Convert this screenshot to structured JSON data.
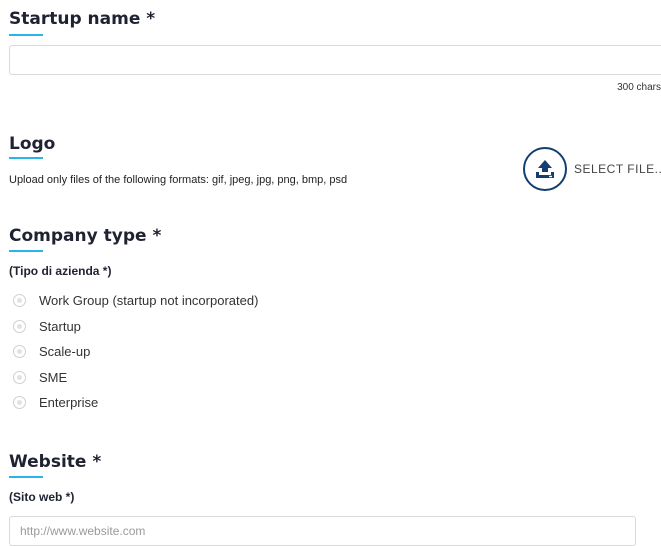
{
  "startup_name": {
    "title": "Startup name *",
    "value": "",
    "counter": "300 chars"
  },
  "logo": {
    "title": "Logo",
    "help": "Upload only files of the following formats: gif, jpeg, jpg, png, bmp, psd",
    "select_label": "SELECT FILE...",
    "icon": "upload-icon",
    "accent_color": "#123e72"
  },
  "company_type": {
    "title": "Company type *",
    "subtitle": "(Tipo di azienda *)",
    "options": [
      {
        "label": "Work Group (startup not incorporated)"
      },
      {
        "label": "Startup"
      },
      {
        "label": "Scale-up"
      },
      {
        "label": "SME"
      },
      {
        "label": "Enterprise"
      }
    ]
  },
  "website": {
    "title": "Website *",
    "subtitle": "(Sito web *)",
    "placeholder": "http://www.website.com",
    "value": ""
  },
  "colors": {
    "underline": "#29b5e8",
    "title": "#1f2230",
    "border": "#d9d9d9"
  }
}
